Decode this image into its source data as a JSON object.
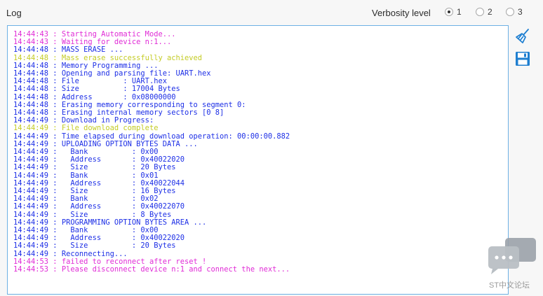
{
  "header": {
    "title": "Log",
    "verbosity_label": "Verbosity level",
    "verbosity_options": [
      {
        "label": "1",
        "selected": true
      },
      {
        "label": "2",
        "selected": false
      },
      {
        "label": "3",
        "selected": false
      }
    ]
  },
  "colors": {
    "info": "#e02bd6",
    "success": "#c4cc26",
    "normal": "#1d2fe6",
    "console_border": "#6db0e4",
    "icon_blue": "#1f7fd0"
  },
  "log": [
    {
      "time": "14:44:43",
      "text": "Starting Automatic Mode...",
      "level": "info"
    },
    {
      "time": "14:44:43",
      "text": "Waiting for device n:1...",
      "level": "info"
    },
    {
      "time": "14:44:48",
      "text": "MASS ERASE ...",
      "level": "normal"
    },
    {
      "time": "14:44:48",
      "text": "Mass erase successfully achieved",
      "level": "success"
    },
    {
      "time": "14:44:48",
      "text": "Memory Programming ...",
      "level": "normal"
    },
    {
      "time": "14:44:48",
      "text": "Opening and parsing file: UART.hex",
      "level": "normal"
    },
    {
      "time": "14:44:48",
      "text": "File          : UART.hex",
      "level": "normal"
    },
    {
      "time": "14:44:48",
      "text": "Size          : 17004 Bytes",
      "level": "normal"
    },
    {
      "time": "14:44:48",
      "text": "Address       : 0x08000000",
      "level": "normal"
    },
    {
      "time": "14:44:48",
      "text": "Erasing memory corresponding to segment 0:",
      "level": "normal"
    },
    {
      "time": "14:44:48",
      "text": "Erasing internal memory sectors [0 8]",
      "level": "normal"
    },
    {
      "time": "14:44:49",
      "text": "Download in Progress:",
      "level": "normal"
    },
    {
      "time": "14:44:49",
      "text": "File download complete",
      "level": "success"
    },
    {
      "time": "14:44:49",
      "text": "Time elapsed during download operation: 00:00:00.882",
      "level": "normal"
    },
    {
      "time": "14:44:49",
      "text": "UPLOADING OPTION BYTES DATA ...",
      "level": "normal"
    },
    {
      "time": "14:44:49",
      "text": "  Bank          : 0x00",
      "level": "normal"
    },
    {
      "time": "14:44:49",
      "text": "  Address       : 0x40022020",
      "level": "normal"
    },
    {
      "time": "14:44:49",
      "text": "  Size          : 20 Bytes",
      "level": "normal"
    },
    {
      "time": "14:44:49",
      "text": "  Bank          : 0x01",
      "level": "normal"
    },
    {
      "time": "14:44:49",
      "text": "  Address       : 0x40022044",
      "level": "normal"
    },
    {
      "time": "14:44:49",
      "text": "  Size          : 16 Bytes",
      "level": "normal"
    },
    {
      "time": "14:44:49",
      "text": "  Bank          : 0x02",
      "level": "normal"
    },
    {
      "time": "14:44:49",
      "text": "  Address       : 0x40022070",
      "level": "normal"
    },
    {
      "time": "14:44:49",
      "text": "  Size          : 8 Bytes",
      "level": "normal"
    },
    {
      "time": "14:44:49",
      "text": "PROGRAMMING OPTION BYTES AREA ...",
      "level": "normal"
    },
    {
      "time": "14:44:49",
      "text": "  Bank          : 0x00",
      "level": "normal"
    },
    {
      "time": "14:44:49",
      "text": "  Address       : 0x40022020",
      "level": "normal"
    },
    {
      "time": "14:44:49",
      "text": "  Size          : 20 Bytes",
      "level": "normal"
    },
    {
      "time": "14:44:49",
      "text": "Reconnecting...",
      "level": "normal"
    },
    {
      "time": "14:44:53",
      "text": "failed to reconnect after reset !",
      "level": "info"
    },
    {
      "time": "14:44:53",
      "text": "Please disconnect device n:1 and connect the next...",
      "level": "info"
    }
  ],
  "tools": [
    {
      "icon": "broom-icon",
      "name": "clear-log-button"
    },
    {
      "icon": "floppy-disk-icon",
      "name": "save-log-button"
    }
  ],
  "watermark": {
    "text": "ST中文论坛"
  }
}
